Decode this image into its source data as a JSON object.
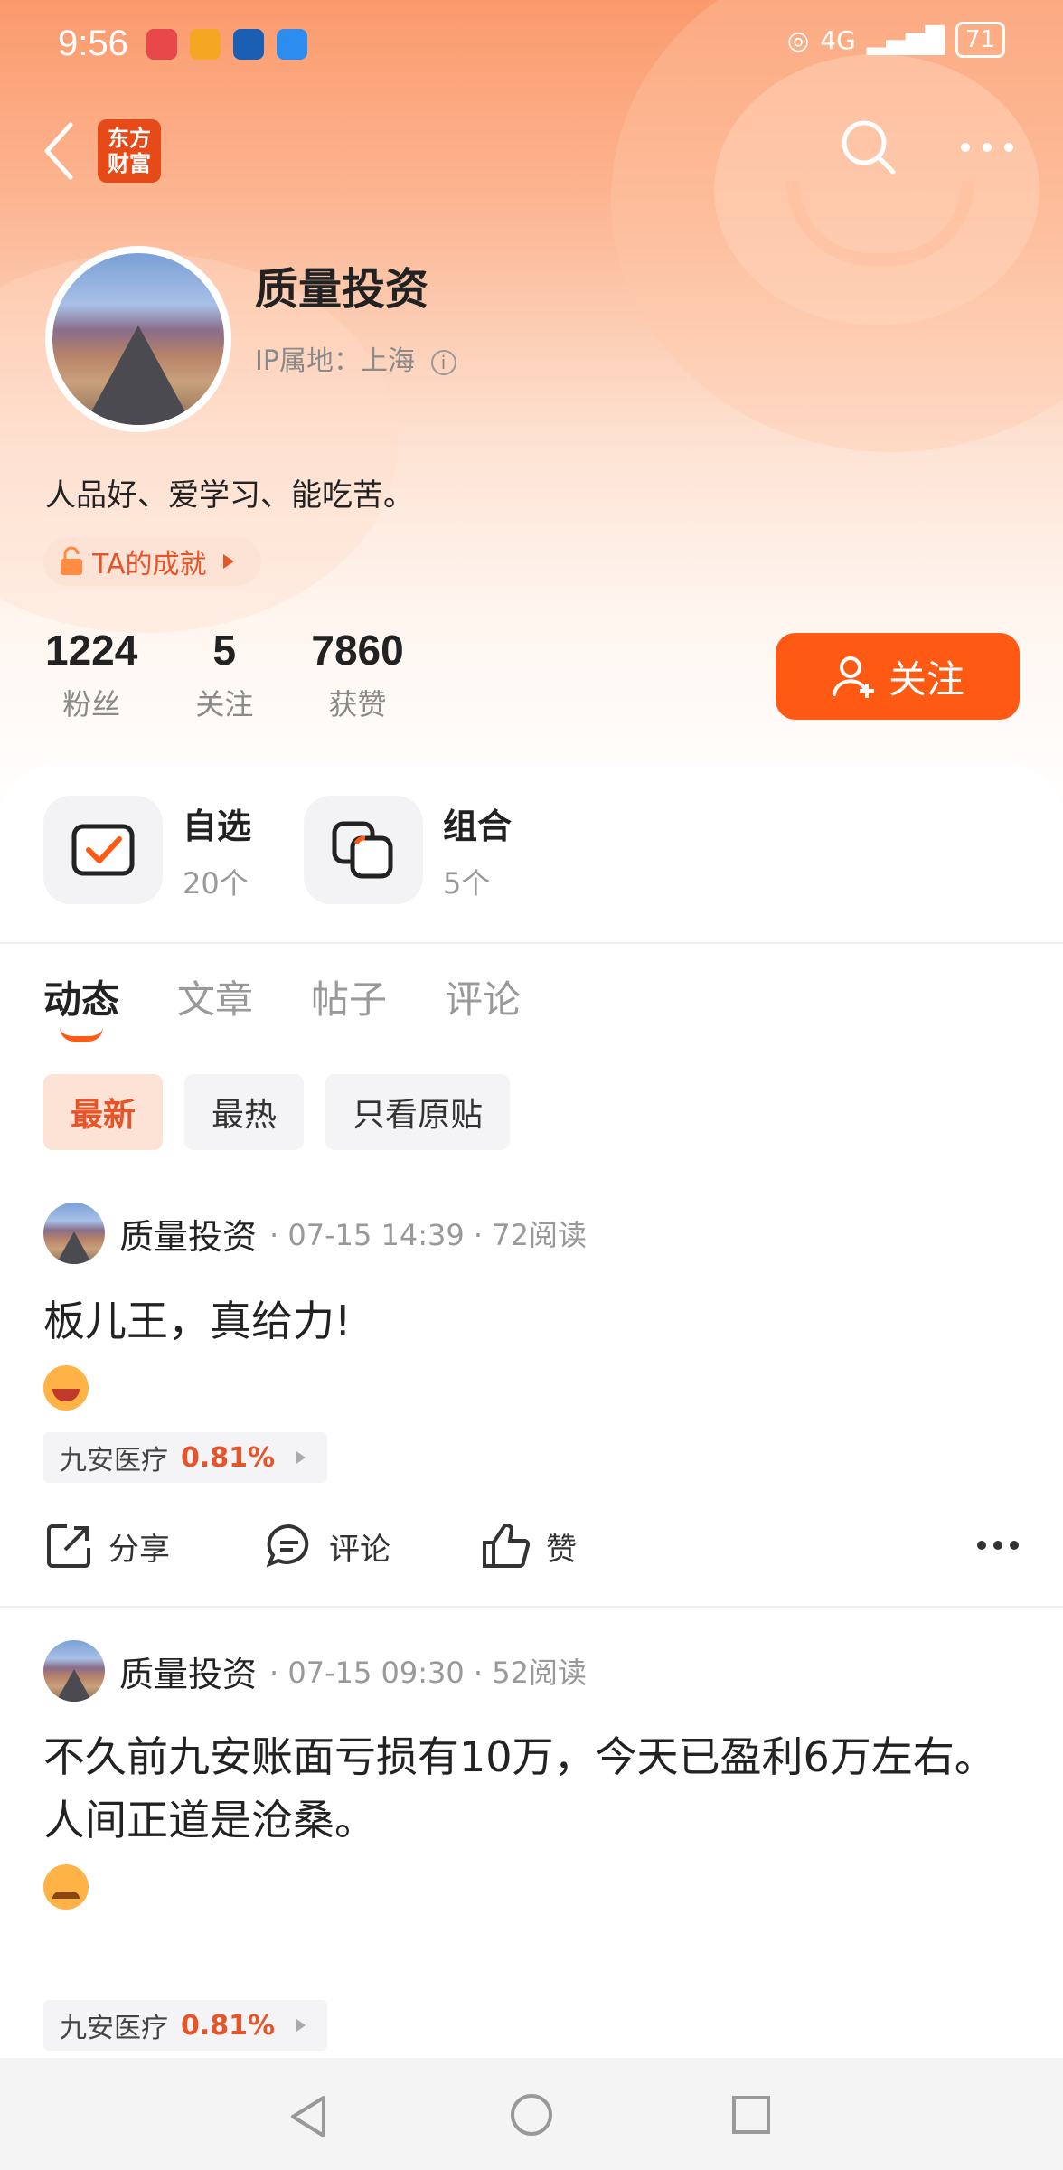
{
  "status": {
    "time": "9:56",
    "battery": "71",
    "network": "4G"
  },
  "nav": {
    "logo_line1": "东方",
    "logo_line2": "财富"
  },
  "profile": {
    "name": "质量投资",
    "ip_label": "IP属地：上海",
    "bio": "人品好、爱学习、能吃苦。",
    "achievement": "TA的成就",
    "stats": [
      {
        "num": "1224",
        "label": "粉丝"
      },
      {
        "num": "5",
        "label": "关注"
      },
      {
        "num": "7860",
        "label": "获赞"
      }
    ],
    "follow_label": "关注"
  },
  "favorites": [
    {
      "title": "自选",
      "count": "20个",
      "icon": "checkbox-icon"
    },
    {
      "title": "组合",
      "count": "5个",
      "icon": "portfolio-icon"
    }
  ],
  "tabs": [
    "动态",
    "文章",
    "帖子",
    "评论"
  ],
  "filters": [
    "最新",
    "最热",
    "只看原贴"
  ],
  "posts": [
    {
      "author": "质量投资",
      "meta": "· 07-15 14:39 · 72阅读",
      "lines": [
        "板儿王，真给力!"
      ],
      "stock_name": "九安医疗",
      "stock_pct": "0.81%"
    },
    {
      "author": "质量投资",
      "meta": "· 07-15 09:30 · 52阅读",
      "lines": [
        "不久前九安账面亏损有10万，今天已盈利6万左右。",
        "人间正道是沧桑。"
      ],
      "stock_name": "九安医疗",
      "stock_pct": "0.81%"
    }
  ],
  "actions": {
    "share": "分享",
    "comment": "评论",
    "like": "赞"
  },
  "colors": {
    "accent": "#ff5a14",
    "accent_light": "#fde3d6"
  }
}
